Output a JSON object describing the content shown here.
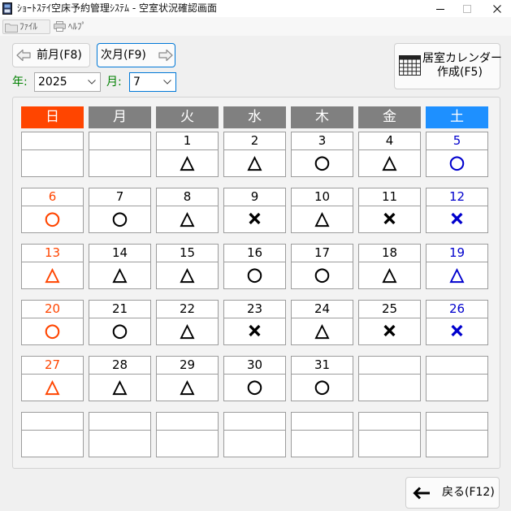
{
  "window": {
    "title": "ｼｮｰﾄｽﾃｲ空床予約管理ｼｽﾃﾑ - 空室状況確認画面",
    "icon": "app-icon",
    "controls": {
      "minimize_icon": "minimize-icon",
      "maximize_icon": "maximize-icon",
      "close_icon": "close-icon"
    }
  },
  "menu": {
    "file": {
      "label": "ﾌｧｲﾙ",
      "icon": "folder-icon"
    },
    "help": {
      "label": "ﾍﾙﾌﾟ",
      "icon": "help-icon"
    }
  },
  "toolbar": {
    "prev_month": {
      "label": "前月(F8)",
      "icon": "arrow-left-outline-icon"
    },
    "next_month": {
      "label": "次月(F9)",
      "icon": "arrow-right-outline-icon"
    },
    "room_calendar": {
      "label_line1": "居室カレンダー",
      "label_line2": "作成(F5)",
      "icon": "calendar-grid-icon"
    }
  },
  "filters": {
    "year_label": "年:",
    "year_value": "2025",
    "month_label": "月:",
    "month_value": "7",
    "dropdown_icon": "chevron-down-icon"
  },
  "calendar": {
    "weekday_headers": [
      "日",
      "月",
      "火",
      "水",
      "木",
      "金",
      "土"
    ],
    "weeks": [
      [
        {
          "day": "",
          "mark": ""
        },
        {
          "day": "",
          "mark": ""
        },
        {
          "day": "1",
          "mark": "△"
        },
        {
          "day": "2",
          "mark": "△"
        },
        {
          "day": "3",
          "mark": "○"
        },
        {
          "day": "4",
          "mark": "△"
        },
        {
          "day": "5",
          "mark": "○"
        }
      ],
      [
        {
          "day": "6",
          "mark": "○"
        },
        {
          "day": "7",
          "mark": "○"
        },
        {
          "day": "8",
          "mark": "△"
        },
        {
          "day": "9",
          "mark": "×"
        },
        {
          "day": "10",
          "mark": "△"
        },
        {
          "day": "11",
          "mark": "×"
        },
        {
          "day": "12",
          "mark": "×"
        }
      ],
      [
        {
          "day": "13",
          "mark": "△"
        },
        {
          "day": "14",
          "mark": "△"
        },
        {
          "day": "15",
          "mark": "△"
        },
        {
          "day": "16",
          "mark": "○"
        },
        {
          "day": "17",
          "mark": "○"
        },
        {
          "day": "18",
          "mark": "△"
        },
        {
          "day": "19",
          "mark": "△"
        }
      ],
      [
        {
          "day": "20",
          "mark": "○"
        },
        {
          "day": "21",
          "mark": "○"
        },
        {
          "day": "22",
          "mark": "△"
        },
        {
          "day": "23",
          "mark": "×"
        },
        {
          "day": "24",
          "mark": "△"
        },
        {
          "day": "25",
          "mark": "×"
        },
        {
          "day": "26",
          "mark": "×"
        }
      ],
      [
        {
          "day": "27",
          "mark": "△"
        },
        {
          "day": "28",
          "mark": "△"
        },
        {
          "day": "29",
          "mark": "△"
        },
        {
          "day": "30",
          "mark": "○"
        },
        {
          "day": "31",
          "mark": "○"
        },
        {
          "day": "",
          "mark": ""
        },
        {
          "day": "",
          "mark": ""
        }
      ],
      [
        {
          "day": "",
          "mark": ""
        },
        {
          "day": "",
          "mark": ""
        },
        {
          "day": "",
          "mark": ""
        },
        {
          "day": "",
          "mark": ""
        },
        {
          "day": "",
          "mark": ""
        },
        {
          "day": "",
          "mark": ""
        },
        {
          "day": "",
          "mark": ""
        }
      ]
    ]
  },
  "footer": {
    "back": {
      "label": "戻る(F12)",
      "icon": "arrow-left-icon"
    }
  },
  "colors": {
    "sunday_header_bg": "#FF4500",
    "weekday_header_bg": "#808080",
    "saturday_header_bg": "#1E90FF",
    "header_text": "#FFFFFF",
    "sunday_text": "#FF4500",
    "saturday_text": "#0000CD",
    "weekday_text": "#000000",
    "field_label": "#008000",
    "focus_border": "#0078D7"
  }
}
